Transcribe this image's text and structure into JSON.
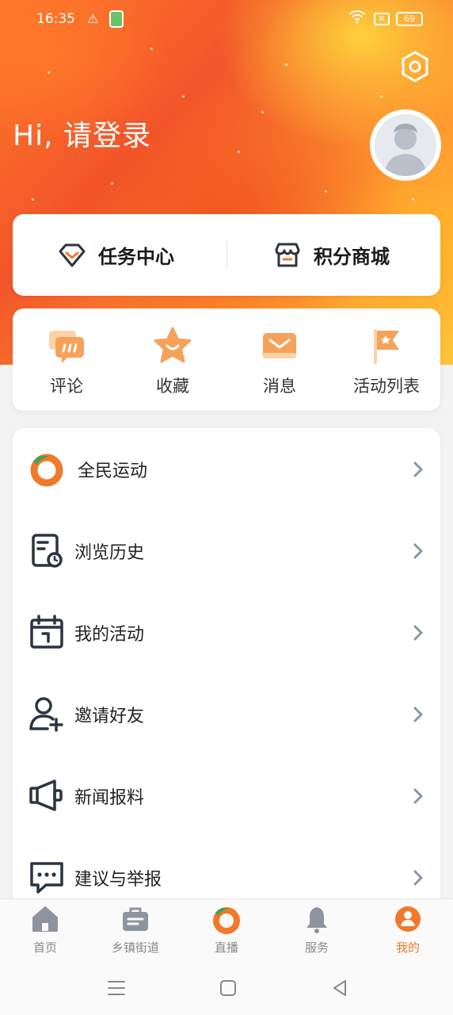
{
  "status": {
    "time": "16:35",
    "battery": "69"
  },
  "header": {
    "greeting": "Hi, 请登录"
  },
  "top_actions": [
    {
      "label": "任务中心",
      "icon": "diamond-check-icon"
    },
    {
      "label": "积分商城",
      "icon": "store-icon"
    }
  ],
  "quick": [
    {
      "label": "评论",
      "icon": "comment-icon"
    },
    {
      "label": "收藏",
      "icon": "star-icon"
    },
    {
      "label": "消息",
      "icon": "envelope-icon"
    },
    {
      "label": "活动列表",
      "icon": "flag-icon"
    }
  ],
  "menu": [
    {
      "label": "全民运动",
      "icon": "sport-logo-icon"
    },
    {
      "label": "浏览历史",
      "icon": "history-doc-icon"
    },
    {
      "label": "我的活动",
      "icon": "calendar-icon"
    },
    {
      "label": "邀请好友",
      "icon": "add-user-icon"
    },
    {
      "label": "新闻报料",
      "icon": "megaphone-icon"
    },
    {
      "label": "建议与举报",
      "icon": "chat-bubble-icon"
    }
  ],
  "tabs": [
    {
      "label": "首页",
      "icon": "home-icon"
    },
    {
      "label": "乡镇街道",
      "icon": "briefcase-icon"
    },
    {
      "label": "直播",
      "icon": "live-logo-icon"
    },
    {
      "label": "服务",
      "icon": "bell-icon"
    },
    {
      "label": "我的",
      "icon": "profile-icon",
      "active": true
    }
  ],
  "colors": {
    "accent": "#f07a2a",
    "icon_dark": "#2b3440",
    "quick_orange": "#f6a25a"
  }
}
